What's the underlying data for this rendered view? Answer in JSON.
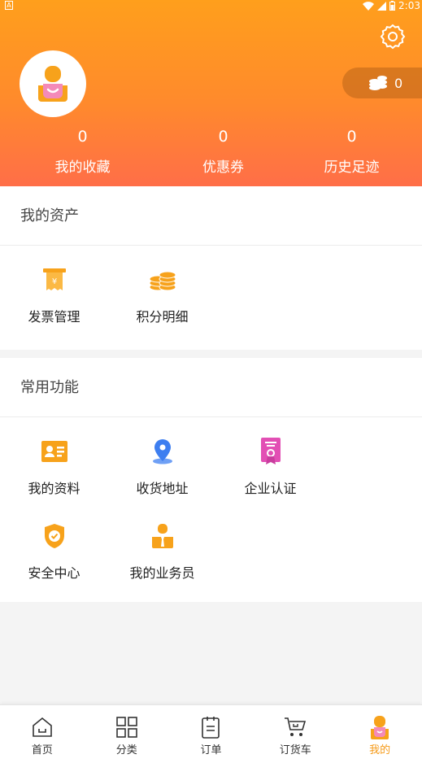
{
  "status_bar": {
    "time": "2:03",
    "indicator": "A"
  },
  "header": {
    "coin_count": "0",
    "stats": [
      {
        "value": "0",
        "label": "我的收藏"
      },
      {
        "value": "0",
        "label": "优惠券"
      },
      {
        "value": "0",
        "label": "历史足迹"
      }
    ]
  },
  "assets": {
    "title": "我的资产",
    "items": [
      {
        "label": "发票管理",
        "icon": "invoice-icon"
      },
      {
        "label": "积分明细",
        "icon": "points-coins-icon"
      }
    ]
  },
  "functions": {
    "title": "常用功能",
    "items": [
      {
        "label": "我的资料",
        "icon": "profile-card-icon"
      },
      {
        "label": "收货地址",
        "icon": "location-pin-icon"
      },
      {
        "label": "企业认证",
        "icon": "certificate-icon"
      },
      {
        "label": "安全中心",
        "icon": "shield-icon"
      },
      {
        "label": "我的业务员",
        "icon": "salesman-icon"
      }
    ]
  },
  "tabbar": {
    "items": [
      {
        "label": "首页",
        "icon": "home-icon"
      },
      {
        "label": "分类",
        "icon": "category-icon"
      },
      {
        "label": "订单",
        "icon": "order-clipboard-icon"
      },
      {
        "label": "订货车",
        "icon": "cart-icon"
      },
      {
        "label": "我的",
        "icon": "user-icon"
      }
    ],
    "active_index": 4
  },
  "colors": {
    "accent": "#f59a18",
    "header_top": "#ff9f1c",
    "header_bottom": "#ff6e48",
    "blue": "#3d7ef0",
    "pink": "#e24fb4"
  }
}
